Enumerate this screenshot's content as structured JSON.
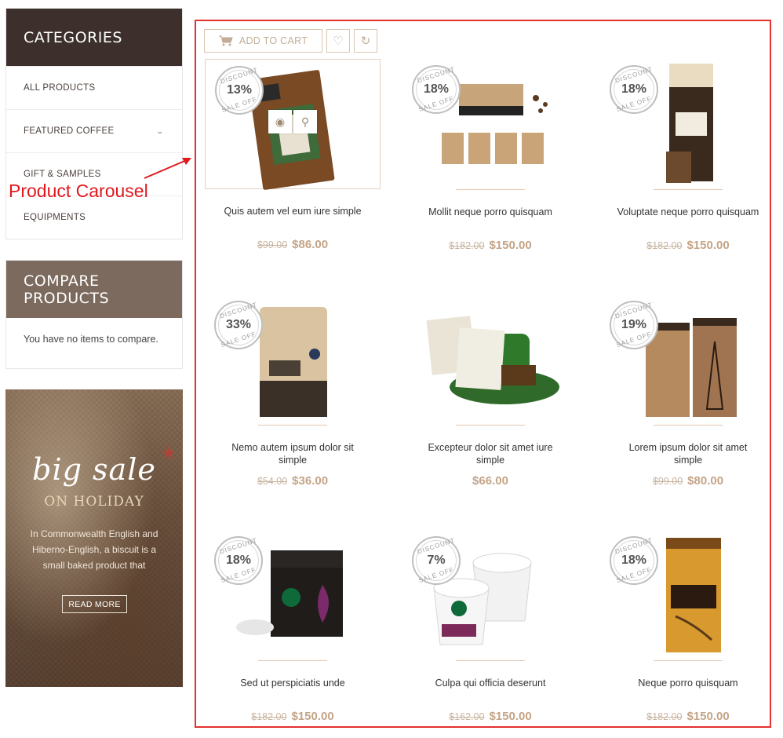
{
  "sidebar": {
    "categories_title": "CATEGORIES",
    "categories": [
      {
        "label": "ALL PRODUCTS"
      },
      {
        "label": "FEATURED COFFEE",
        "icon": "chevron-down-icon"
      },
      {
        "label": "GIFT & SAMPLES"
      },
      {
        "label": "EQUIPMENTS"
      }
    ],
    "compare_title": "COMPARE PRODUCTS",
    "compare_text": "You have no items to compare.",
    "banner": {
      "headline": "big sale",
      "subheadline": "ON HOLIDAY",
      "description": "In Commonwealth English and Hiberno-English, a biscuit is a small baked product that",
      "button": "READ MORE"
    }
  },
  "annotation": {
    "label": "Product Carousel",
    "color": "#e0191f"
  },
  "toolbar": {
    "add_to_cart": "ADD TO CART"
  },
  "badge": {
    "top": "DISCOUNT",
    "bottom": "SALE OFF"
  },
  "products": [
    {
      "name": "Quis autem vel eum iure simple",
      "old_price": "$99.00",
      "price": "$86.00",
      "discount": "13%"
    },
    {
      "name": "Mollit neque porro quisquam",
      "old_price": "$182.00",
      "price": "$150.00",
      "discount": "18%"
    },
    {
      "name": "Voluptate neque porro quisquam",
      "old_price": "$182.00",
      "price": "$150.00",
      "discount": "18%"
    },
    {
      "name": "Nemo autem ipsum dolor sit simple",
      "old_price": "$54.00",
      "price": "$36.00",
      "discount": "33%"
    },
    {
      "name": "Excepteur dolor sit amet iure simple",
      "old_price": "",
      "price": "$66.00",
      "discount": ""
    },
    {
      "name": "Lorem ipsum dolor sit amet simple",
      "old_price": "$99.00",
      "price": "$80.00",
      "discount": "19%"
    },
    {
      "name": "Sed ut perspiciatis unde",
      "old_price": "$182.00",
      "price": "$150.00",
      "discount": "18%"
    },
    {
      "name": "Culpa qui officia deserunt",
      "old_price": "$162.00",
      "price": "$150.00",
      "discount": "7%"
    },
    {
      "name": "Neque porro quisquam",
      "old_price": "$182.00",
      "price": "$150.00",
      "discount": "18%"
    }
  ],
  "colors": {
    "accent": "#c4a487",
    "dark_header": "#3d302c",
    "compare_header": "#7b6a5d",
    "border_red": "#e53030"
  }
}
